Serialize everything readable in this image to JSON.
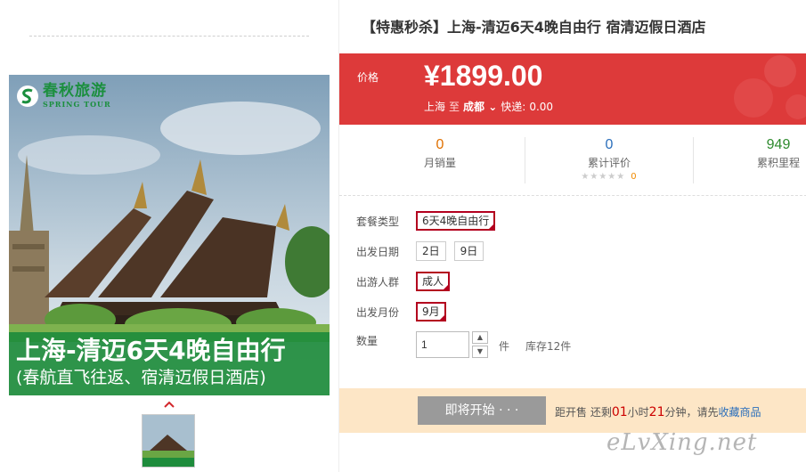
{
  "hero": {
    "logo_cn": "春秋旅游",
    "logo_en": "SPRING TOUR",
    "banner_title": "上海-清迈6天4晚自由行",
    "banner_subtitle": "(春航直飞往返、宿清迈假日酒店)"
  },
  "thumbnail": {
    "caption": "上海-清迈6天4晚自由行"
  },
  "product": {
    "title": "【特惠秒杀】上海-清迈6天4晚自由行 宿清迈假日酒店",
    "price_label": "价格",
    "price": "¥1899.00",
    "route_from": "上海",
    "route_to_word": "至",
    "route_city": "成都",
    "express_label": "快递:",
    "express_value": "0.00"
  },
  "stats": {
    "monthly_sales_value": "0",
    "monthly_sales_label": "月销量",
    "reviews_value": "0",
    "reviews_label": "累计评价",
    "review_stars": "★★★★★",
    "review_count": "0",
    "points_value": "949",
    "points_label": "累积里程"
  },
  "options": {
    "package_label": "套餐类型",
    "package_selected": "6天4晚自由行",
    "date_label": "出发日期",
    "dates": [
      "2日",
      "9日"
    ],
    "group_label": "出游人群",
    "group_selected": "成人",
    "month_label": "出发月份",
    "month_selected": "9月",
    "qty_label": "数量",
    "qty_value": "1",
    "qty_unit": "件",
    "stock": "库存12件"
  },
  "sale": {
    "button_label": "即将开始 · · ·",
    "countdown_prefix": "距开售 还剩",
    "hours": "01",
    "hours_unit": "小时",
    "minutes": "21",
    "minutes_unit": "分钟，请先",
    "favorite_link": "收藏商品"
  },
  "watermark": "eLvXing.net",
  "colors": {
    "price_red": "#dd3a3a",
    "brand_green": "#1b8f3e",
    "selected_border": "#b3001e",
    "sale_bar": "#fde6c6"
  }
}
